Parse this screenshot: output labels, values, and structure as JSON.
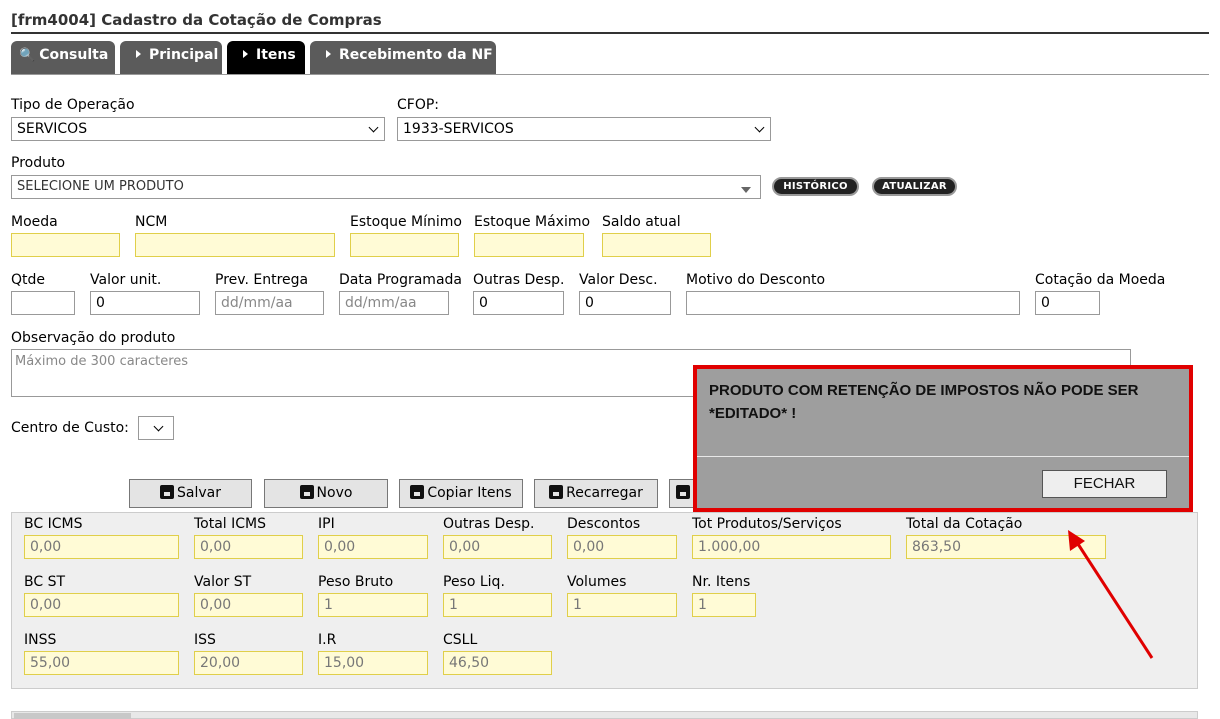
{
  "title": "[frm4004] Cadastro da Cotação de Compras",
  "tabs": [
    {
      "label": "Consulta",
      "icon": "magnifier-icon",
      "active": false
    },
    {
      "label": "Principal",
      "icon": "triangle-right-icon",
      "active": false
    },
    {
      "label": "Itens",
      "icon": "triangle-right-icon",
      "active": true
    },
    {
      "label": "Recebimento da NF",
      "icon": "triangle-right-icon",
      "active": false
    }
  ],
  "form": {
    "tipo_operacao": {
      "label": "Tipo de Operação",
      "value": "SERVICOS"
    },
    "cfop": {
      "label": "CFOP:",
      "value": "1933-SERVICOS"
    },
    "produto": {
      "label": "Produto",
      "value": "SELECIONE UM PRODUTO"
    },
    "historico_btn": "HISTÓRICO",
    "atualizar_btn": "ATUALIZAR",
    "moeda": {
      "label": "Moeda",
      "value": ""
    },
    "ncm": {
      "label": "NCM",
      "value": ""
    },
    "estoque_minimo": {
      "label": "Estoque Mínimo",
      "value": ""
    },
    "estoque_maximo": {
      "label": "Estoque Máximo",
      "value": ""
    },
    "saldo_atual": {
      "label": "Saldo atual",
      "value": ""
    },
    "qtde": {
      "label": "Qtde",
      "value": ""
    },
    "valor_unit": {
      "label": "Valor unit.",
      "value": "0"
    },
    "prev_entrega": {
      "label": "Prev. Entrega",
      "placeholder": "dd/mm/aa"
    },
    "data_programada": {
      "label": "Data Programada",
      "placeholder": "dd/mm/aa"
    },
    "outras_desp": {
      "label": "Outras Desp.",
      "value": "0"
    },
    "valor_desc": {
      "label": "Valor Desc.",
      "value": "0"
    },
    "motivo_desconto": {
      "label": "Motivo do Desconto",
      "value": ""
    },
    "cotacao_moeda": {
      "label": "Cotação da Moeda",
      "value": "0"
    },
    "observacao": {
      "label": "Observação do produto",
      "placeholder": "Máximo de 300 caracteres"
    },
    "centro_custo": {
      "label": "Centro de Custo:",
      "value": ""
    }
  },
  "toolbar": {
    "salvar": "Salvar",
    "novo": "Novo",
    "copiar": "Copiar Itens",
    "recarregar": "Recarregar"
  },
  "totals": {
    "bc_icms": {
      "label": "BC ICMS",
      "value": "0,00"
    },
    "total_icms": {
      "label": "Total ICMS",
      "value": "0,00"
    },
    "ipi": {
      "label": "IPI",
      "value": "0,00"
    },
    "outras_desp": {
      "label": "Outras Desp.",
      "value": "0,00"
    },
    "descontos": {
      "label": "Descontos",
      "value": "0,00"
    },
    "tot_produtos": {
      "label": "Tot Produtos/Serviços",
      "value": "1.000,00"
    },
    "total_cotacao": {
      "label": "Total da Cotação",
      "value": "863,50"
    },
    "bc_st": {
      "label": "BC ST",
      "value": "0,00"
    },
    "valor_st": {
      "label": "Valor ST",
      "value": "0,00"
    },
    "peso_bruto": {
      "label": "Peso Bruto",
      "value": "1"
    },
    "peso_liq": {
      "label": "Peso Liq.",
      "value": "1"
    },
    "volumes": {
      "label": "Volumes",
      "value": "1"
    },
    "nr_itens": {
      "label": "Nr. Itens",
      "value": "1"
    },
    "inss": {
      "label": "INSS",
      "value": "55,00"
    },
    "iss": {
      "label": "ISS",
      "value": "20,00"
    },
    "ir": {
      "label": "I.R",
      "value": "15,00"
    },
    "csll": {
      "label": "CSLL",
      "value": "46,50"
    }
  },
  "modal": {
    "message": "PRODUTO COM RETENÇÃO DE IMPOSTOS NÃO PODE SER *EDITADO* !",
    "close_label": "FECHAR",
    "border_color": "#e00000"
  }
}
